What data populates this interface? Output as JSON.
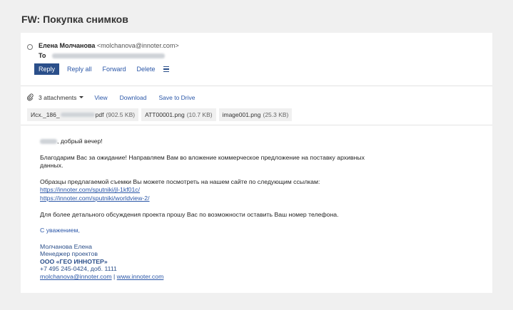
{
  "subject": "FW: Покупка снимков",
  "sender": {
    "name": "Елена Молчанова",
    "email": "<molchanova@innoter.com>"
  },
  "to_label": "To",
  "actions": {
    "reply": "Reply",
    "reply_all": "Reply all",
    "forward": "Forward",
    "delete": "Delete"
  },
  "attachments": {
    "count_label": "3 attachments",
    "view": "View",
    "download": "Download",
    "save": "Save to Drive",
    "files": [
      {
        "name_prefix": "Исх._186_",
        "name_suffix": "pdf",
        "size": "(902.5 KB)"
      },
      {
        "name": "ATT00001.png",
        "size": "(10.7 KB)"
      },
      {
        "name": "image001.png",
        "size": "(25.3 KB)"
      }
    ]
  },
  "body": {
    "greeting": ", добрый вечер!",
    "para1": "Благодарим Вас за ожидание! Направляем Вам во вложение коммерческое предложение на поставку архивных данных.",
    "para2": "Образцы предлагаемой съемки Вы можете посмотреть на нашем сайте по следующим ссылкам:",
    "link1": "https://innoter.com/sputniki/jl-1kf01c/",
    "link2": "https://innoter.com/sputniki/worldview-2/",
    "para3": "Для более детального обсуждения проекта прошу Вас по возможности оставить Ваш номер телефона.",
    "regards": "С уважением,",
    "sig_name": "Молчанова Елена",
    "sig_title": "Менеджер проектов",
    "sig_company": "ООО «ГЕО ИННОТЕР»",
    "sig_phone": "+7 495 245-0424, доб. 1111",
    "sig_email": "molchanova@innoter.com",
    "sig_sep": " | ",
    "sig_site": "www.innoter.com"
  }
}
